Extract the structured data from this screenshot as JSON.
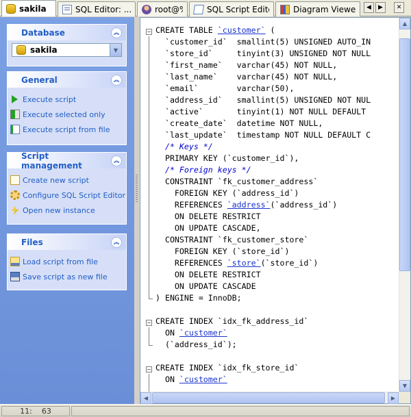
{
  "tabs": [
    {
      "label": "sakila",
      "icon": "database-icon",
      "active": true
    },
    {
      "label": "SQL Editor: ...",
      "icon": "sql-editor-icon",
      "active": false
    },
    {
      "label": "root@%",
      "icon": "user-icon",
      "active": false
    },
    {
      "label": "SQL Script Editor",
      "icon": "script-icon",
      "active": false
    },
    {
      "label": "Diagram Viewer",
      "icon": "diagram-icon",
      "active": false
    }
  ],
  "tabnav": {
    "prev": "◀",
    "next": "▶",
    "close": "✕"
  },
  "sidebar": {
    "database": {
      "title": "Database",
      "selected": "sakila"
    },
    "general": {
      "title": "General",
      "items": [
        {
          "label": "Execute script",
          "icon": "play-icon"
        },
        {
          "label": "Execute selected only",
          "icon": "execute-selected-icon"
        },
        {
          "label": "Execute script from file",
          "icon": "execute-file-icon"
        }
      ]
    },
    "script_management": {
      "title": "Script management",
      "items": [
        {
          "label": "Create new script",
          "icon": "new-script-icon"
        },
        {
          "label": "Configure SQL Script Editor",
          "icon": "configure-icon"
        },
        {
          "label": "Open new instance",
          "icon": "lightning-icon"
        }
      ]
    },
    "files": {
      "title": "Files",
      "items": [
        {
          "label": "Load script from file",
          "icon": "load-file-icon"
        },
        {
          "label": "Save script as new file",
          "icon": "save-file-icon"
        }
      ]
    }
  },
  "editor": {
    "lines": [
      "CREATE TABLE `customer` (",
      "  `customer_id`  smallint(5) UNSIGNED AUTO_IN",
      "  `store_id`     tinyint(3) UNSIGNED NOT NULL",
      "  `first_name`   varchar(45) NOT NULL,",
      "  `last_name`    varchar(45) NOT NULL,",
      "  `email`        varchar(50),",
      "  `address_id`   smallint(5) UNSIGNED NOT NUL",
      "  `active`       tinyint(1) NOT NULL DEFAULT ",
      "  `create_date`  datetime NOT NULL,",
      "  `last_update`  timestamp NOT NULL DEFAULT C",
      "  /* Keys */",
      "  PRIMARY KEY (`customer_id`),",
      "  /* Foreign keys */",
      "  CONSTRAINT `fk_customer_address`",
      "    FOREIGN KEY (`address_id`)",
      "    REFERENCES `address`(`address_id`)",
      "    ON DELETE RESTRICT",
      "    ON UPDATE CASCADE,",
      "  CONSTRAINT `fk_customer_store`",
      "    FOREIGN KEY (`store_id`)",
      "    REFERENCES `store`(`store_id`)",
      "    ON DELETE RESTRICT",
      "    ON UPDATE CASCADE",
      ") ENGINE = InnoDB;",
      "",
      "CREATE INDEX `idx_fk_address_id`",
      "  ON `customer`",
      "  (`address_id`);",
      "",
      "CREATE INDEX `idx_fk_store_id`",
      "  ON `customer`"
    ]
  },
  "status": {
    "line": "11:",
    "col": "63"
  }
}
